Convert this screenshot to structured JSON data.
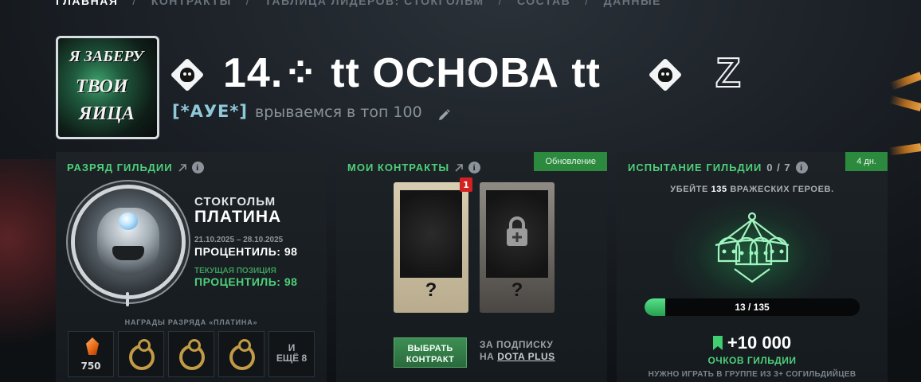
{
  "breadcrumb": [
    "ГЛАВНАЯ",
    "КОНТРАКТЫ",
    "ТАБЛИЦА ЛИДЕРОВ: СТОКГОЛЬМ",
    "СОСТАВ",
    "ДАННЫЕ"
  ],
  "breadcrumb_sep": "/",
  "guild": {
    "logo_lines": [
      "Я ЗАБЕРУ",
      "ТВОИ",
      "ЯИЦА"
    ],
    "name": "14.⁘ tt ОСНОВА tt",
    "z_mark": "Z",
    "tag": "[*АУЕ*]",
    "motto": "врываемся в топ 100"
  },
  "rank_panel": {
    "title": "РАЗРЯД ГИЛЬДИИ",
    "city": "СТОКГОЛЬМ",
    "rank": "ПЛАТИНА",
    "dates": "21.10.2025 – 28.10.2025",
    "percentile": "ПРОЦЕНТИЛЬ: 98",
    "current_position": "ТЕКУЩАЯ ПОЗИЦИЯ",
    "current_percentile": "ПРОЦЕНТИЛЬ: 98",
    "rewards_title": "НАГРАДЫ РАЗРЯДА «ПЛАТИНА»",
    "shard_amount": "750",
    "more_line1": "И",
    "more_line2": "ЕЩЁ 8"
  },
  "contracts_panel": {
    "title": "МОИ КОНТРАКТЫ",
    "corner": "Обновление",
    "badge": "1",
    "card_q": "?",
    "pick_line1": "ВЫБРАТЬ",
    "pick_line2": "КОНТРАКТ",
    "sub_line1": "ЗА ПОДПИСКУ",
    "sub_prefix": "НА",
    "sub_link": "DOTA PLUS"
  },
  "challenge_panel": {
    "title": "ИСПЫТАНИЕ ГИЛЬДИИ",
    "count": "0 / 7",
    "corner": "4 дн.",
    "quest_pre": "УБЕЙТЕ",
    "quest_num": "135",
    "quest_post": "ВРАЖЕСКИХ ГЕРОЕВ.",
    "progress_label": "13 / 135",
    "progress_fraction": 0.096,
    "points": "+10 000",
    "points_label": "ОЧКОВ ГИЛЬДИИ",
    "requirement": "НУЖНО ИГРАТЬ В ГРУППЕ ИЗ 3+ СОГИЛЬДИЙЦЕВ"
  },
  "colors": {
    "accent_green": "#4ed07a",
    "badge_red": "#d32121",
    "tag_blue": "#8fc8d8"
  }
}
